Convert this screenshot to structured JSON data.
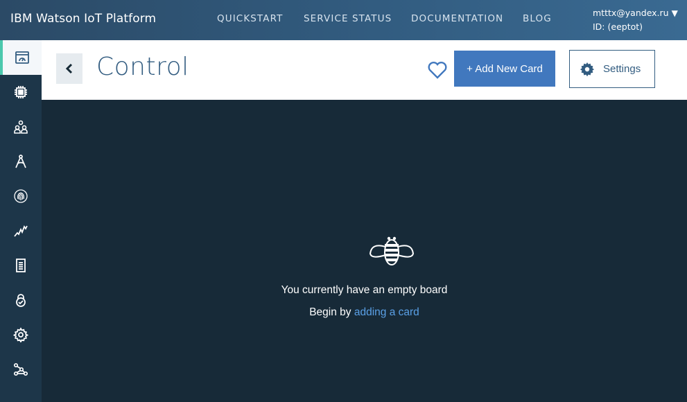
{
  "topbar": {
    "brand": "IBM Watson IoT Platform",
    "nav": [
      "QUICKSTART",
      "SERVICE STATUS",
      "DOCUMENTATION",
      "BLOG"
    ],
    "user_email": "mtttx@yandex.ru",
    "user_id": "ID: (eeptot)",
    "caret": "▼"
  },
  "sidebar": {
    "items": [
      {
        "icon": "boards-icon",
        "active": true
      },
      {
        "icon": "devices-icon"
      },
      {
        "icon": "members-icon"
      },
      {
        "icon": "rules-icon"
      },
      {
        "icon": "security-fingerprint-icon"
      },
      {
        "icon": "analytics-icon"
      },
      {
        "icon": "logs-icon"
      },
      {
        "icon": "lock-icon"
      },
      {
        "icon": "settings-icon"
      },
      {
        "icon": "extensions-icon"
      }
    ]
  },
  "header": {
    "title": "Control",
    "add_card_label": "+ Add New Card",
    "settings_label": "Settings"
  },
  "board": {
    "empty_message": "You currently have an empty board",
    "begin_prefix": "Begin by ",
    "begin_link": "adding a card"
  },
  "colors": {
    "accent": "#4178be",
    "active_marker": "#4bc8ad",
    "link": "#5aa0e6"
  }
}
